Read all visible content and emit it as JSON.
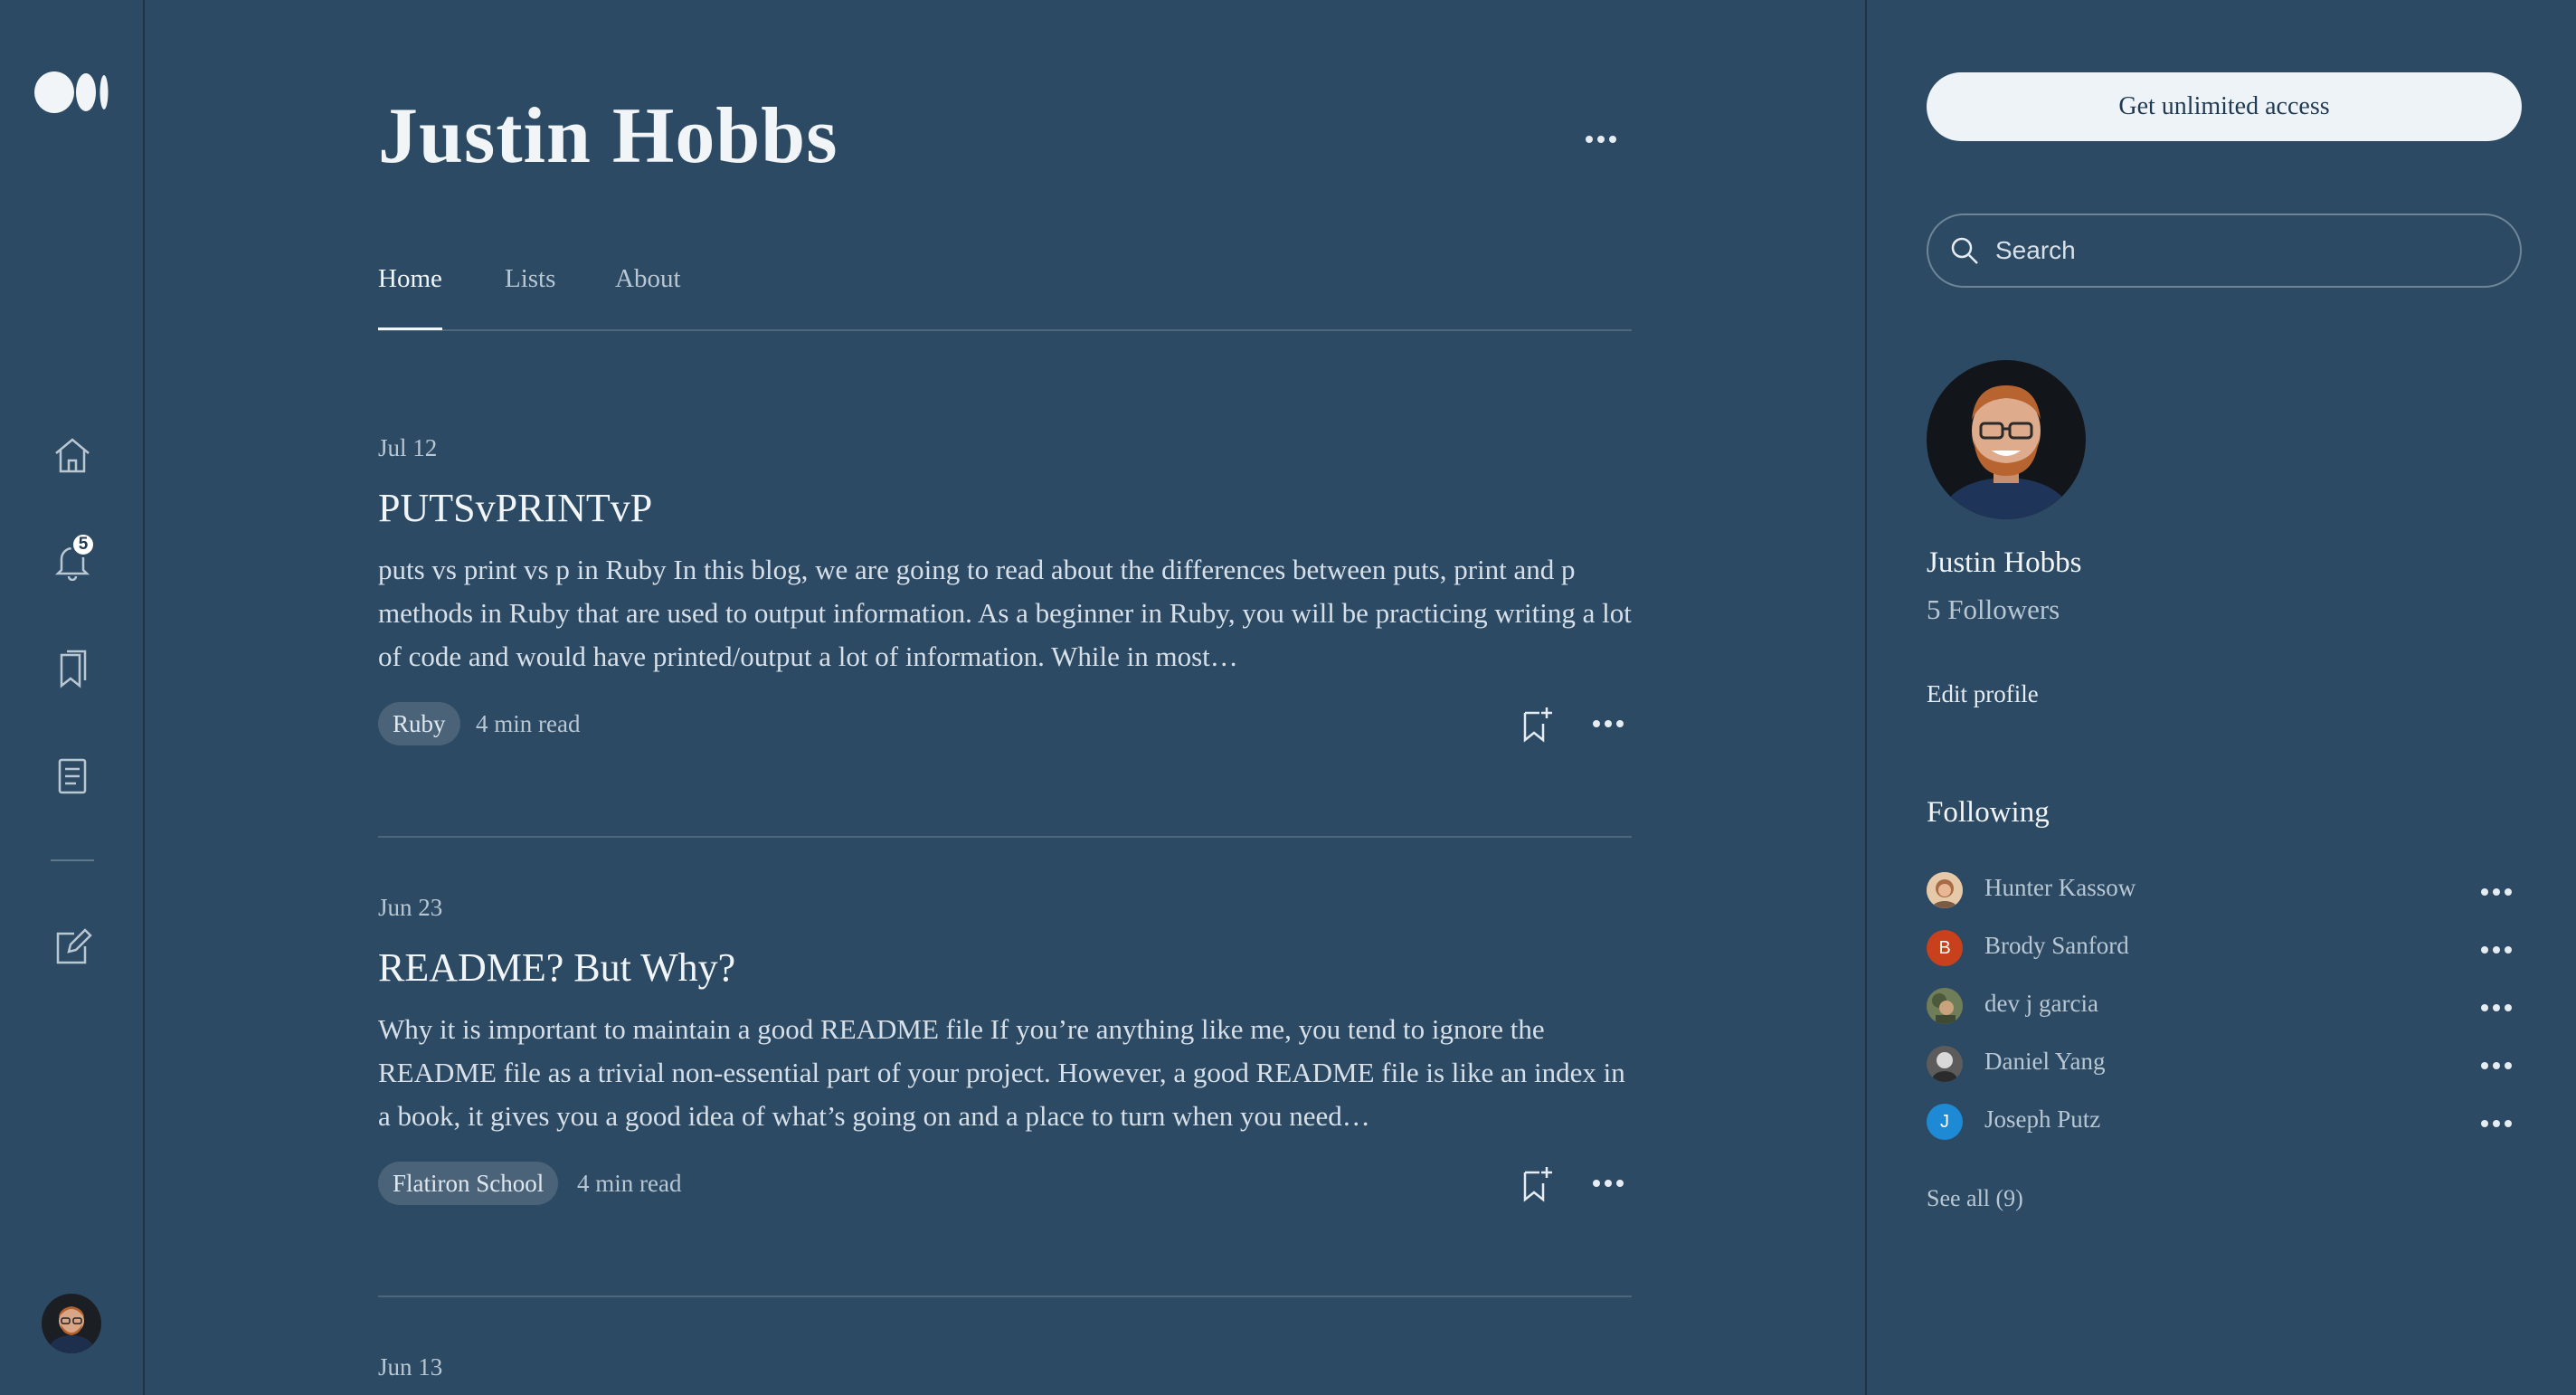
{
  "nav": {
    "notifications_count": "5"
  },
  "profile": {
    "name": "Justin Hobbs",
    "followers": "5 Followers",
    "edit_label": "Edit profile"
  },
  "tabs": [
    {
      "label": "Home",
      "active": true
    },
    {
      "label": "Lists",
      "active": false
    },
    {
      "label": "About",
      "active": false
    }
  ],
  "posts": [
    {
      "date": "Jul 12",
      "title": "PUTSvPRINTvP",
      "excerpt": "puts vs print vs p in Ruby In this blog, we are going to read about the differences between puts, print and p methods in Ruby that are used to output information. As a beginner in Ruby, you will be practicing writing a lot of code and would have printed/output a lot of information. While in most…",
      "tag": "Ruby",
      "read_time": "4 min read"
    },
    {
      "date": "Jun 23",
      "title": "README? But Why?",
      "excerpt": "Why it is important to maintain a good README file If you’re anything like me, you tend to ignore the README file as a trivial non-essential part of your project. However, a good README file is like an index in a book, it gives you a good idea of what’s going on and a place to turn when you need…",
      "tag": "Flatiron School",
      "read_time": "4 min read"
    },
    {
      "date": "Jun 13"
    }
  ],
  "sidebar": {
    "cta_label": "Get unlimited access",
    "search_placeholder": "Search",
    "following_heading": "Following",
    "following": [
      {
        "name": "Hunter Kassow",
        "avatar": "photo"
      },
      {
        "name": "Brody Sanford",
        "avatar": "initial",
        "initial": "B",
        "color": "#c8401c"
      },
      {
        "name": "dev j garcia",
        "avatar": "photo"
      },
      {
        "name": "Daniel Yang",
        "avatar": "photo"
      },
      {
        "name": "Joseph Putz",
        "avatar": "initial",
        "initial": "J",
        "color": "#1e8ad6"
      }
    ],
    "see_all_label": "See all (9)"
  },
  "colors": {
    "background": "#2c4a63",
    "accent_text": "#f2f5f8",
    "muted_text": "#b9c7d3"
  }
}
